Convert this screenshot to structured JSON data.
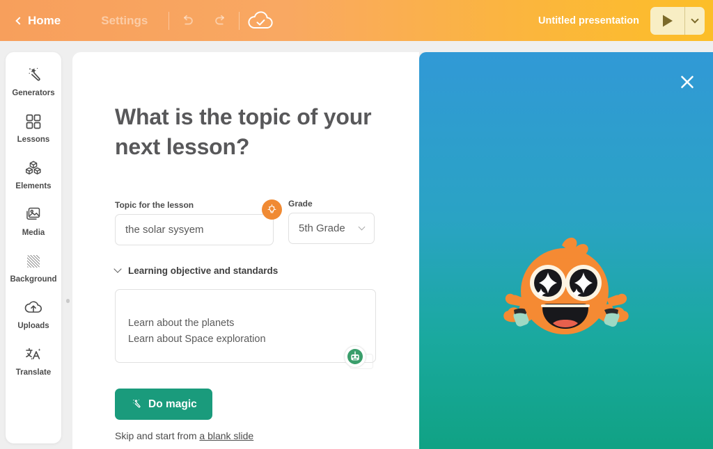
{
  "header": {
    "home_label": "Home",
    "settings_label": "Settings",
    "back_icon": "chevron-left-icon",
    "undo_icon": "undo-icon",
    "redo_icon": "redo-icon",
    "save_status_icon": "cloud-check-icon",
    "presentation_title": "Untitled presentation",
    "play_icon": "play-icon",
    "play_caret_icon": "chevron-down-icon",
    "colors": {
      "gradient_start": "#f79f5c",
      "gradient_end": "#fcbe28",
      "play_bg": "#f8eec4",
      "play_fg": "#7c6a2a"
    }
  },
  "sidebar": {
    "items": [
      {
        "label": "Generators",
        "icon": "magic-wand-icon"
      },
      {
        "label": "Lessons",
        "icon": "grid-squares-icon"
      },
      {
        "label": "Elements",
        "icon": "cubes-icon"
      },
      {
        "label": "Media",
        "icon": "photos-icon"
      },
      {
        "label": "Background",
        "icon": "hatch-pattern-icon"
      },
      {
        "label": "Uploads",
        "icon": "cloud-upload-icon"
      },
      {
        "label": "Translate",
        "icon": "translate-icon"
      }
    ]
  },
  "main": {
    "headline": "What is the topic of your next lesson?",
    "topic": {
      "label": "Topic for the lesson",
      "value": "the solar sysyem",
      "placeholder": "Topic for the lesson"
    },
    "grade": {
      "label": "Grade",
      "value": "5th Grade",
      "caret_icon": "chevron-down-icon"
    },
    "hint_badge_icon": "lightbulb-icon",
    "objective": {
      "title": "Learning objective and standards",
      "caret_icon": "chevron-down-icon",
      "value": "Learn about the planets\nLearn about Space exploration",
      "assistant_icon": "robot-icon"
    },
    "magic_button": {
      "label": "Do magic",
      "icon": "magic-wand-icon",
      "color": "#1a9b7c"
    },
    "skip": {
      "prefix": "Skip and start from ",
      "link_label": "a blank slide"
    }
  },
  "right_panel": {
    "close_icon": "close-icon",
    "mascot_icon": "orange-mascot-star-eyes-icon",
    "colors": {
      "gradient_top": "#3199d6",
      "gradient_bottom": "#10a284",
      "mascot_body": "#f58a33"
    }
  }
}
